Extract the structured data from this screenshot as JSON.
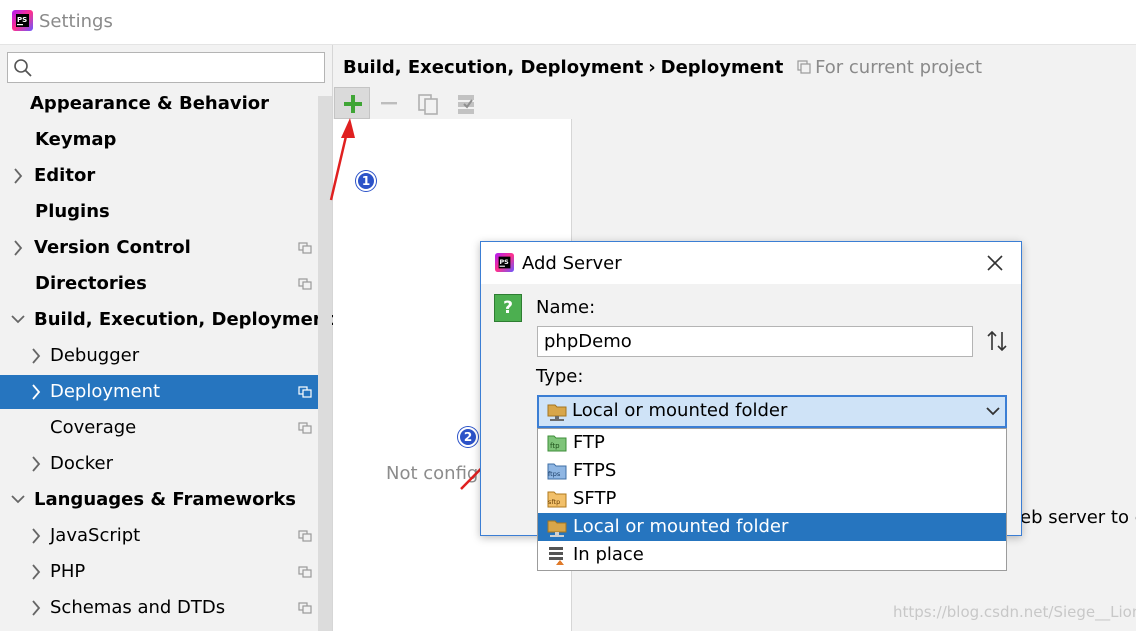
{
  "window": {
    "title": "Settings"
  },
  "sidebar": {
    "search": {
      "placeholder": ""
    },
    "items": [
      {
        "label": "Appearance & Behavior",
        "bold": true,
        "expandable": false,
        "indent": 0,
        "project_icon": false
      },
      {
        "label": "Keymap",
        "bold": true,
        "expandable": false,
        "indent": 0,
        "project_icon": false
      },
      {
        "label": "Editor",
        "bold": true,
        "expandable": true,
        "expanded": false,
        "indent": 0,
        "project_icon": false
      },
      {
        "label": "Plugins",
        "bold": true,
        "expandable": false,
        "indent": 0,
        "project_icon": false
      },
      {
        "label": "Version Control",
        "bold": true,
        "expandable": true,
        "expanded": false,
        "indent": 0,
        "project_icon": true
      },
      {
        "label": "Directories",
        "bold": true,
        "expandable": false,
        "indent": 0,
        "project_icon": true
      },
      {
        "label": "Build, Execution, Deployment",
        "bold": true,
        "expandable": true,
        "expanded": true,
        "indent": 0,
        "project_icon": false
      },
      {
        "label": "Debugger",
        "bold": false,
        "expandable": true,
        "expanded": false,
        "indent": 1,
        "project_icon": false
      },
      {
        "label": "Deployment",
        "bold": false,
        "expandable": true,
        "expanded": false,
        "indent": 1,
        "project_icon": true,
        "selected": true
      },
      {
        "label": "Coverage",
        "bold": false,
        "expandable": false,
        "indent": 1,
        "project_icon": true
      },
      {
        "label": "Docker",
        "bold": false,
        "expandable": true,
        "expanded": false,
        "indent": 1,
        "project_icon": false
      },
      {
        "label": "Languages & Frameworks",
        "bold": true,
        "expandable": true,
        "expanded": true,
        "indent": 0,
        "project_icon": false
      },
      {
        "label": "JavaScript",
        "bold": false,
        "expandable": true,
        "expanded": false,
        "indent": 1,
        "project_icon": true
      },
      {
        "label": "PHP",
        "bold": false,
        "expandable": true,
        "expanded": false,
        "indent": 1,
        "project_icon": true
      },
      {
        "label": "Schemas and DTDs",
        "bold": false,
        "expandable": true,
        "expanded": false,
        "indent": 1,
        "project_icon": true
      }
    ]
  },
  "main": {
    "breadcrumb": {
      "part1": "Build, Execution, Deployment",
      "separator": "›",
      "part2": "Deployment",
      "scope": "For current project"
    },
    "toolbar": {
      "add_icon": "plus-icon",
      "remove_icon": "minus-icon",
      "copy_icon": "copy-icon",
      "default_icon": "set-default-icon"
    },
    "empty_text": "Not configu",
    "behind_text": "eb server to c"
  },
  "annotations": {
    "badge1": "1",
    "badge2": "2"
  },
  "dialog": {
    "title": "Add Server",
    "help_label": "?",
    "name_label": "Name:",
    "name_value": "phpDemo",
    "type_label": "Type:",
    "type_selected": "Local or mounted folder",
    "options": [
      {
        "label": "FTP",
        "icon": "ftp-icon",
        "selected": false
      },
      {
        "label": "FTPS",
        "icon": "ftps-icon",
        "selected": false
      },
      {
        "label": "SFTP",
        "icon": "sftp-icon",
        "selected": false
      },
      {
        "label": "Local or mounted folder",
        "icon": "local-folder-icon",
        "selected": true
      },
      {
        "label": "In place",
        "icon": "in-place-icon",
        "selected": false
      }
    ]
  },
  "watermark": "https://blog.csdn.net/Siege__Lion",
  "colors": {
    "accent": "#2675bf",
    "focus_border": "#3b7ed4",
    "add_green": "#3fa535",
    "arrow_red": "#e02020",
    "badge_blue": "#2b52c8"
  }
}
